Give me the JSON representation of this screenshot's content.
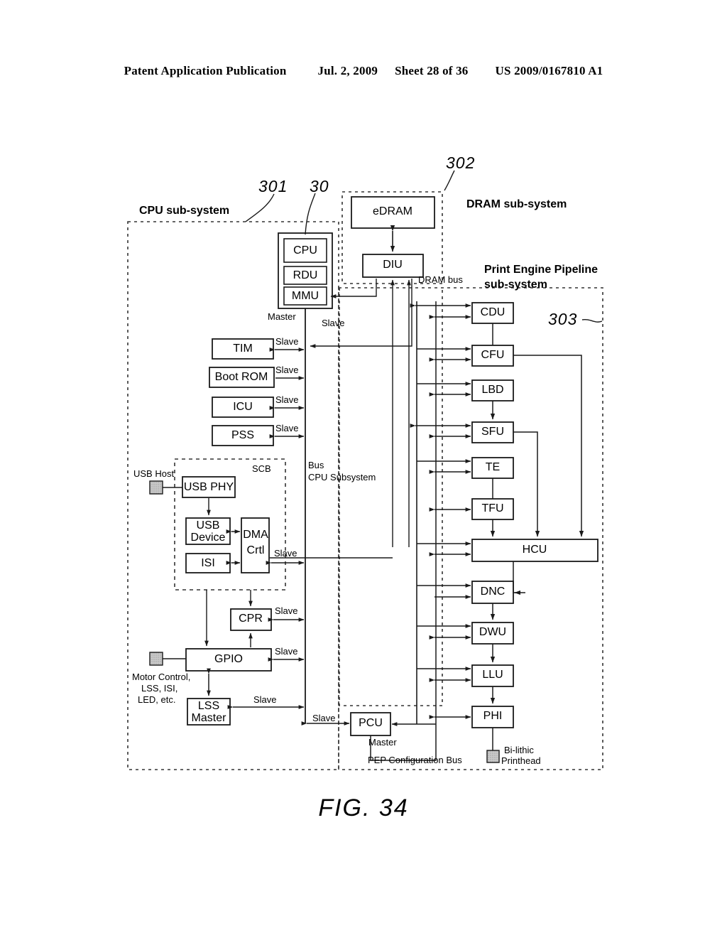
{
  "header": {
    "publication": "Patent Application Publication",
    "date": "Jul. 2, 2009",
    "sheet": "Sheet 28 of 36",
    "patent_number": "US 2009/0167810 A1"
  },
  "figure": {
    "caption": "FIG. 34"
  },
  "reference_numerals": [
    {
      "id": "301",
      "label": "301"
    },
    {
      "id": "30",
      "label": "30"
    },
    {
      "id": "302",
      "label": "302"
    },
    {
      "id": "303",
      "label": "303"
    }
  ],
  "subsystems": {
    "cpu": "CPU sub-system",
    "dram": "DRAM sub-system",
    "pep_line1": "Print Engine Pipeline",
    "pep_line2": "sub-system",
    "scb": "SCB"
  },
  "blocks": {
    "cpu": "CPU",
    "rdu": "RDU",
    "mmu": "MMU",
    "edram": "eDRAM",
    "diu": "DIU",
    "tim": "TIM",
    "boot_rom": "Boot ROM",
    "icu": "ICU",
    "pss": "PSS",
    "usb_phy": "USB PHY",
    "usb_device_l1": "USB",
    "usb_device_l2": "Device",
    "isi": "ISI",
    "dma_l1": "DMA",
    "dma_l2": "Crtl",
    "cpr": "CPR",
    "gpio": "GPIO",
    "lss_l1": "LSS",
    "lss_l2": "Master",
    "pcu": "PCU",
    "cdu": "CDU",
    "cfu": "CFU",
    "lbd": "LBD",
    "sfu": "SFU",
    "te": "TE",
    "tfu": "TFU",
    "hcu": "HCU",
    "dnc": "DNC",
    "dwu": "DWU",
    "llu": "LLU",
    "phi": "PHI"
  },
  "labels": {
    "master_cpu": "Master",
    "slave_cpu_top": "Slave",
    "slave_tim": "Slave",
    "slave_bootrom": "Slave",
    "slave_icu": "Slave",
    "slave_pss": "Slave",
    "slave_dma": "Slave",
    "slave_cpr": "Slave",
    "slave_gpio": "Slave",
    "slave_lss": "Slave",
    "slave_pcu": "Slave",
    "master_pcu": "Master",
    "dram_bus": "DRAM bus",
    "bus_line1": "Bus",
    "bus_line2": "CPU Subsystem",
    "pep_config_bus": "PEP Configuration Bus",
    "usb_host": "USB Host",
    "motor_l1": "Motor Control,",
    "motor_l2": "LSS, ISI,",
    "motor_l3": "LED, etc.",
    "printhead_l1": "Bi-lithic",
    "printhead_l2": "Printhead"
  },
  "colors": {
    "line": "#1a1a1a",
    "box_fill": "#ffffff",
    "pad_fill": "#bdbdbd",
    "dash": "#333333"
  }
}
